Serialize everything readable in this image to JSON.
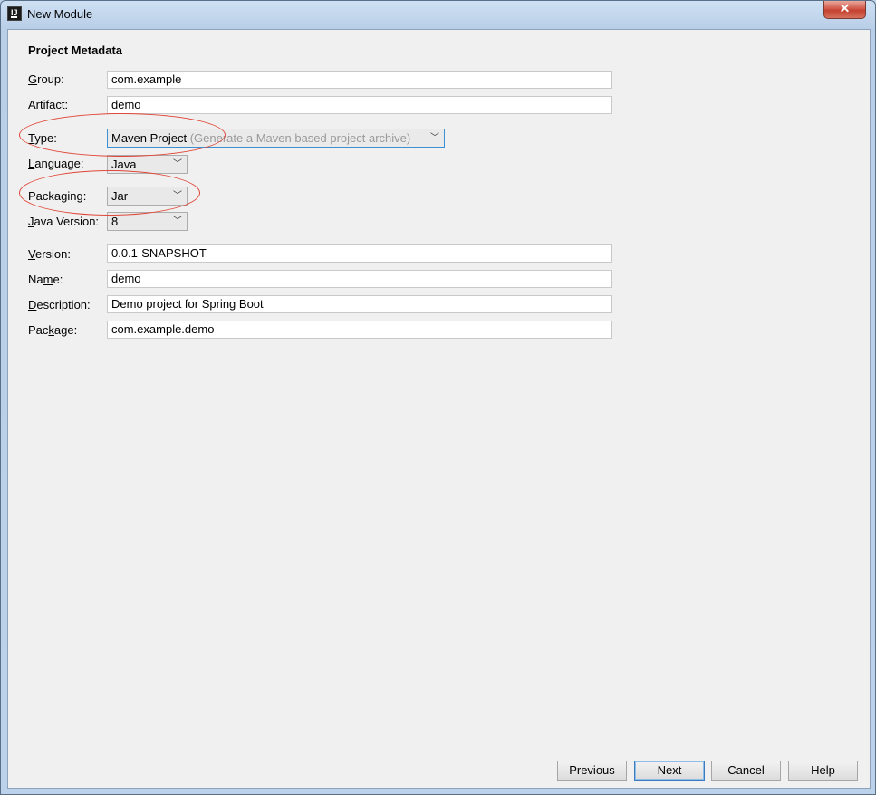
{
  "window": {
    "title": "New Module",
    "close_glyph": "✕",
    "app_icon_text": "IJ"
  },
  "section_title": "Project Metadata",
  "fields": {
    "group": {
      "label_pre": "",
      "mnemonic": "G",
      "label_post": "roup:",
      "value": "com.example"
    },
    "artifact": {
      "label_pre": "",
      "mnemonic": "A",
      "label_post": "rtifact:",
      "value": "demo"
    },
    "type": {
      "label_pre": "",
      "mnemonic": "T",
      "label_post": "ype:",
      "value": "Maven Project",
      "hint": "(Generate a Maven based project archive)"
    },
    "language": {
      "label_pre": "",
      "mnemonic": "L",
      "label_post": "anguage:",
      "value": "Java"
    },
    "packaging": {
      "label_pre": "Packa",
      "mnemonic": "g",
      "label_post": "ing:",
      "value": "Jar"
    },
    "java_version": {
      "label_pre": "",
      "mnemonic": "J",
      "label_post": "ava Version:",
      "value": "8"
    },
    "version": {
      "label_pre": "",
      "mnemonic": "V",
      "label_post": "ersion:",
      "value": "0.0.1-SNAPSHOT"
    },
    "name": {
      "label_pre": "Na",
      "mnemonic": "m",
      "label_post": "e:",
      "value": "demo"
    },
    "description": {
      "label_pre": "",
      "mnemonic": "D",
      "label_post": "escription:",
      "value": "Demo project for Spring Boot"
    },
    "package": {
      "label_pre": "Pac",
      "mnemonic": "k",
      "label_post": "age:",
      "value": "com.example.demo"
    }
  },
  "buttons": {
    "previous": "Previous",
    "next": "Next",
    "cancel": "Cancel",
    "help": "Help"
  },
  "icons": {
    "dropdown": "chevron-down-icon",
    "close": "close-icon"
  },
  "colors": {
    "annotation": "#e0483a",
    "focus": "#3c8fd1"
  }
}
